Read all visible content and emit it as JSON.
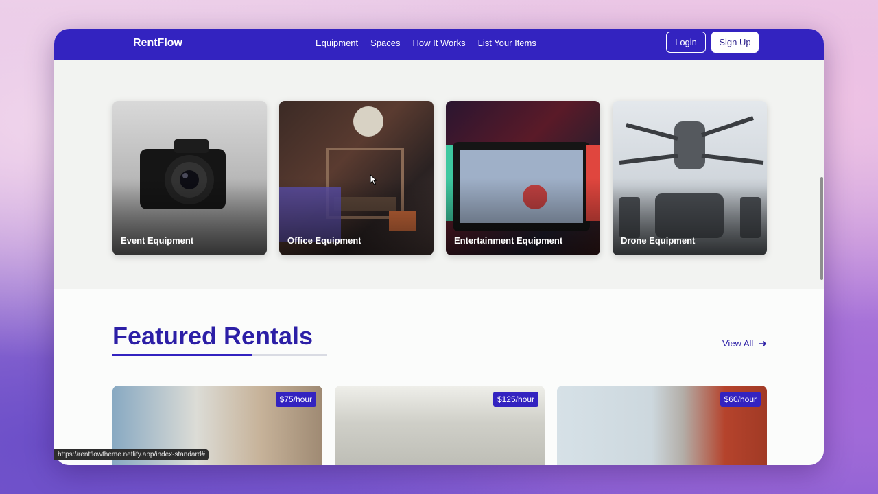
{
  "nav": {
    "brand": "RentFlow",
    "links": [
      "Equipment",
      "Spaces",
      "How It Works",
      "List Your Items"
    ],
    "login_label": "Login",
    "signup_label": "Sign Up"
  },
  "categories": [
    {
      "label": "Event Equipment",
      "icon": "camera-image"
    },
    {
      "label": "Office Equipment",
      "icon": "3d-printer-image"
    },
    {
      "label": "Entertainment Equipment",
      "icon": "game-console-image"
    },
    {
      "label": "Drone Equipment",
      "icon": "drone-image"
    }
  ],
  "featured": {
    "title": "Featured Rentals",
    "view_all_label": "View All",
    "rentals": [
      {
        "price": "$75/hour"
      },
      {
        "price": "$125/hour"
      },
      {
        "price": "$60/hour"
      }
    ]
  },
  "status_bar_url": "https://rentflowtheme.netlify.app/index-standard#",
  "colors": {
    "primary": "#3323c0",
    "title": "#2c1fa6"
  }
}
